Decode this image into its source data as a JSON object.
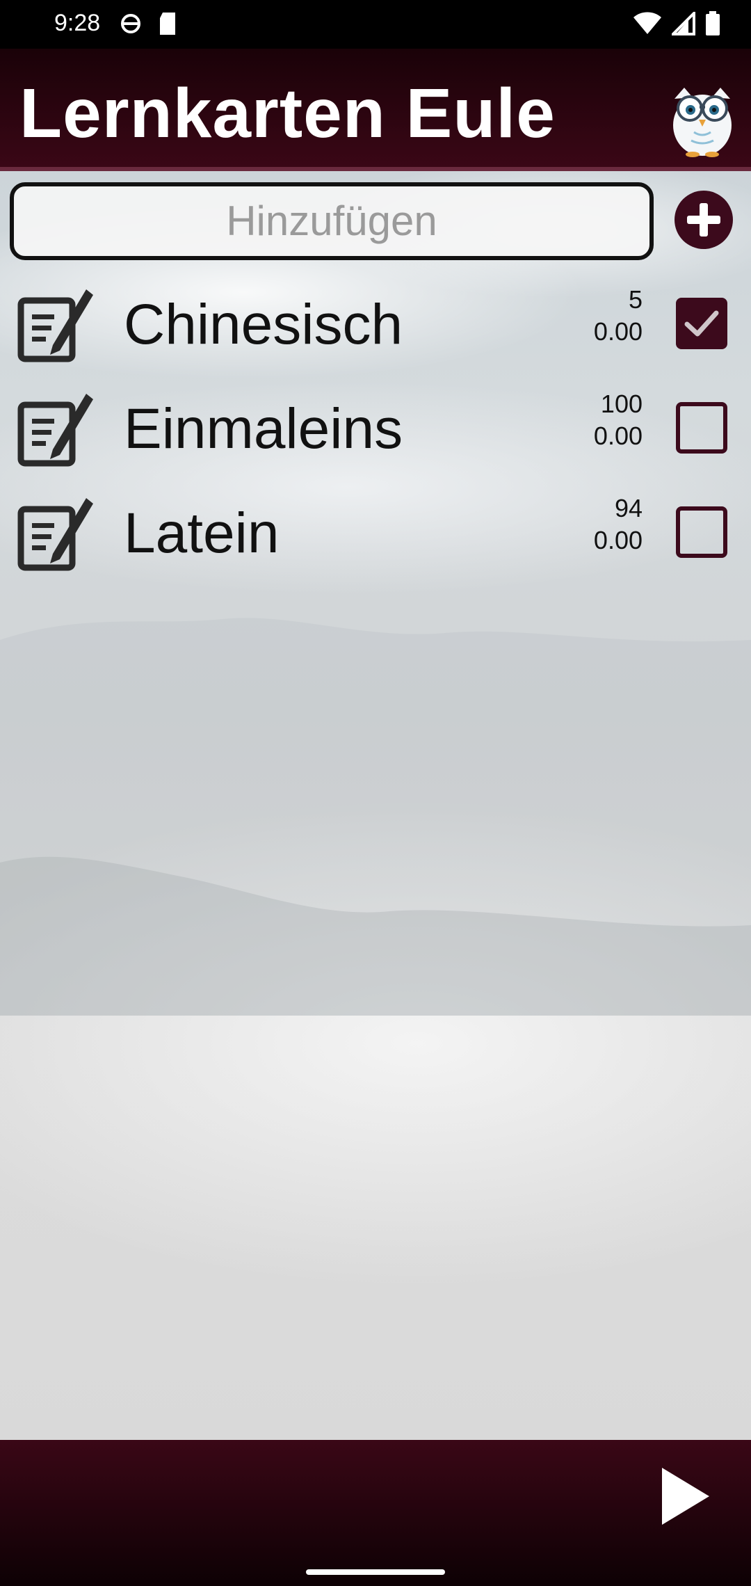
{
  "status_bar": {
    "time": "9:28"
  },
  "header": {
    "title": "Lernkarten Eule"
  },
  "add": {
    "placeholder": "Hinzufügen"
  },
  "decks": [
    {
      "name": "Chinesisch",
      "count": "5",
      "score": "0.00",
      "checked": true
    },
    {
      "name": "Einmaleins",
      "count": "100",
      "score": "0.00",
      "checked": false
    },
    {
      "name": "Latein",
      "count": "94",
      "score": "0.00",
      "checked": false
    }
  ],
  "colors": {
    "accent": "#3c0a1c",
    "header_bg": "#2a0410",
    "text": "#111111"
  },
  "icons": {
    "edit": "edit-note-icon",
    "add": "plus-circle-icon",
    "play": "play-icon",
    "logo": "owl-logo"
  }
}
